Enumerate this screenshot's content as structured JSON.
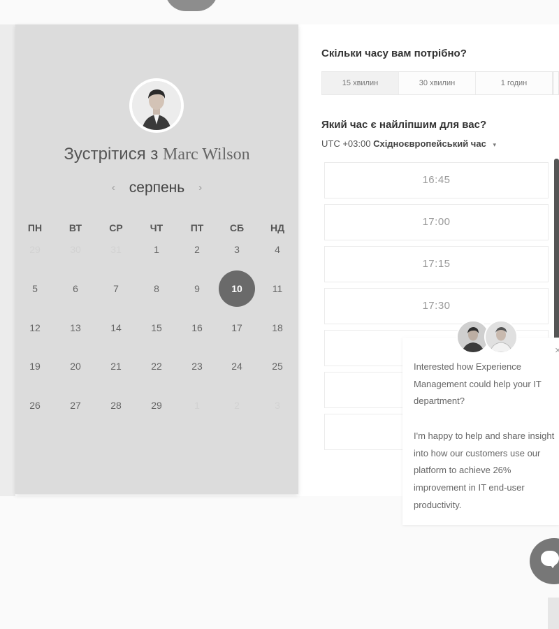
{
  "calendar": {
    "title_prefix": "Зустрітися з",
    "host_name": "Marc Wilson",
    "month": "серпень",
    "prev_icon": "‹",
    "next_icon": "›",
    "weekdays": [
      "ПН",
      "ВТ",
      "СР",
      "ЧТ",
      "ПТ",
      "СБ",
      "НД"
    ],
    "weeks": [
      [
        {
          "d": "29",
          "muted": true
        },
        {
          "d": "30",
          "muted": true
        },
        {
          "d": "31",
          "muted": true
        },
        {
          "d": "1"
        },
        {
          "d": "2"
        },
        {
          "d": "3"
        },
        {
          "d": "4"
        }
      ],
      [
        {
          "d": "5"
        },
        {
          "d": "6"
        },
        {
          "d": "7"
        },
        {
          "d": "8"
        },
        {
          "d": "9"
        },
        {
          "d": "10",
          "selected": true
        },
        {
          "d": "11"
        }
      ],
      [
        {
          "d": "12"
        },
        {
          "d": "13"
        },
        {
          "d": "14"
        },
        {
          "d": "15"
        },
        {
          "d": "16"
        },
        {
          "d": "17"
        },
        {
          "d": "18"
        }
      ],
      [
        {
          "d": "19"
        },
        {
          "d": "20"
        },
        {
          "d": "21"
        },
        {
          "d": "22"
        },
        {
          "d": "23"
        },
        {
          "d": "24"
        },
        {
          "d": "25"
        }
      ],
      [
        {
          "d": "26"
        },
        {
          "d": "27"
        },
        {
          "d": "28"
        },
        {
          "d": "29"
        },
        {
          "d": "1",
          "muted": true
        },
        {
          "d": "2",
          "muted": true
        },
        {
          "d": "3",
          "muted": true
        }
      ]
    ]
  },
  "booking": {
    "duration_question": "Скільки часу вам потрібно?",
    "durations": [
      "15 хвилин",
      "30 хвилин",
      "1 годин"
    ],
    "time_question": "Який час є найліпшим для вас?",
    "tz_offset": "UTC +03:00",
    "tz_name": "Східноєвропейський час",
    "tz_caret": "▾",
    "slots": [
      "16:45",
      "17:00",
      "17:15",
      "17:30",
      "",
      "",
      ""
    ]
  },
  "chat": {
    "message_1": "Interested how Experience Management could help your IT department?",
    "message_2": "I'm happy to help and share insight into how our customers use our platform to achieve 26% improvement in IT end-user productivity.",
    "close_icon": "×"
  }
}
